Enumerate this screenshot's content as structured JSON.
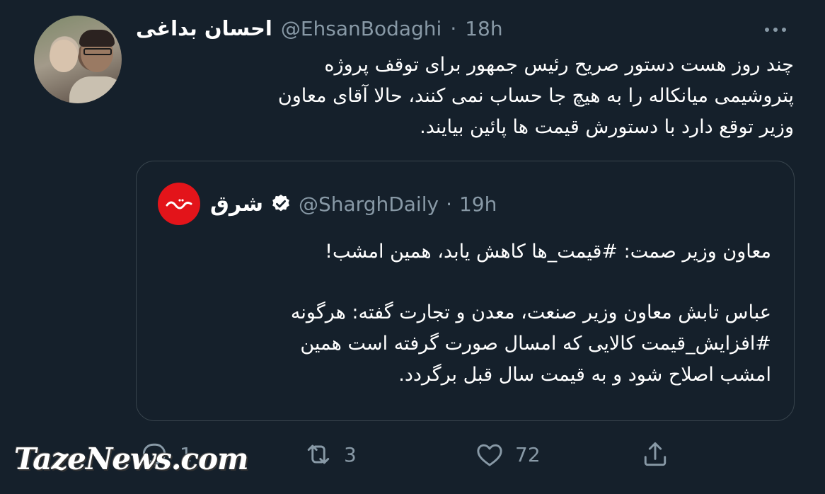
{
  "tweet": {
    "display_name": "احسان بداغی",
    "handle": "@EhsanBodaghi",
    "separator": "·",
    "time": "18h",
    "text_lines": [
      "چند روز هست دستور صریح رئیس جمهور برای توقف پروژه",
      "پتروشیمی میانکاله را به هیچ جا حساب نمی کنند، حالا آقای معاون",
      "وزیر توقع دارد با دستورش قیمت ها پائین بیایند."
    ]
  },
  "quote": {
    "display_name": "شرق",
    "handle": "@SharghDaily",
    "separator": "·",
    "time": "19h",
    "line1": "معاون وزیر صمت: #قیمت_ها کاهش یابد، همین امشب!",
    "para2_lines": [
      "عباس تابش معاون وزیر صنعت، معدن و تجارت گفته: هرگونه",
      "#افزایش_قیمت کالایی که امسال صورت گرفته است همین",
      "امشب اصلاح شود و به قیمت سال قبل برگردد."
    ]
  },
  "actions": {
    "reply_count": "1",
    "retweet_count": "3",
    "like_count": "72"
  },
  "watermark": "TazeNews.com",
  "colors": {
    "background": "#15202b",
    "secondary_text": "#8899a6",
    "border": "#38444d",
    "logo_red": "#e3141a"
  },
  "icons": [
    "more-icon",
    "verified-icon",
    "reply-icon",
    "retweet-icon",
    "like-icon",
    "share-icon"
  ]
}
